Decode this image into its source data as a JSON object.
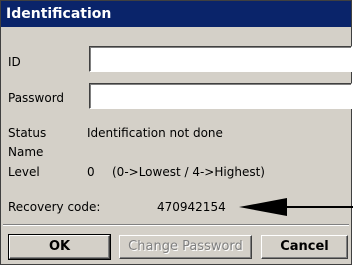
{
  "window": {
    "title": "Identification"
  },
  "form": {
    "id_label": "ID",
    "id_value": "",
    "password_label": "Password",
    "password_value": ""
  },
  "status": {
    "status_label": "Status",
    "status_value": "Identification not done",
    "name_label": "Name",
    "name_value": "",
    "level_label": "Level",
    "level_value": "0",
    "level_hint": "(0->Lowest / 4->Highest)"
  },
  "recovery": {
    "label": "Recovery code:",
    "value": "470942154"
  },
  "buttons": {
    "ok_label": "OK",
    "change_password_label": "Change Password",
    "cancel_label": "Cancel"
  },
  "colors": {
    "titlebar": "#0a246a",
    "dialog_bg": "#d4d0c8"
  }
}
